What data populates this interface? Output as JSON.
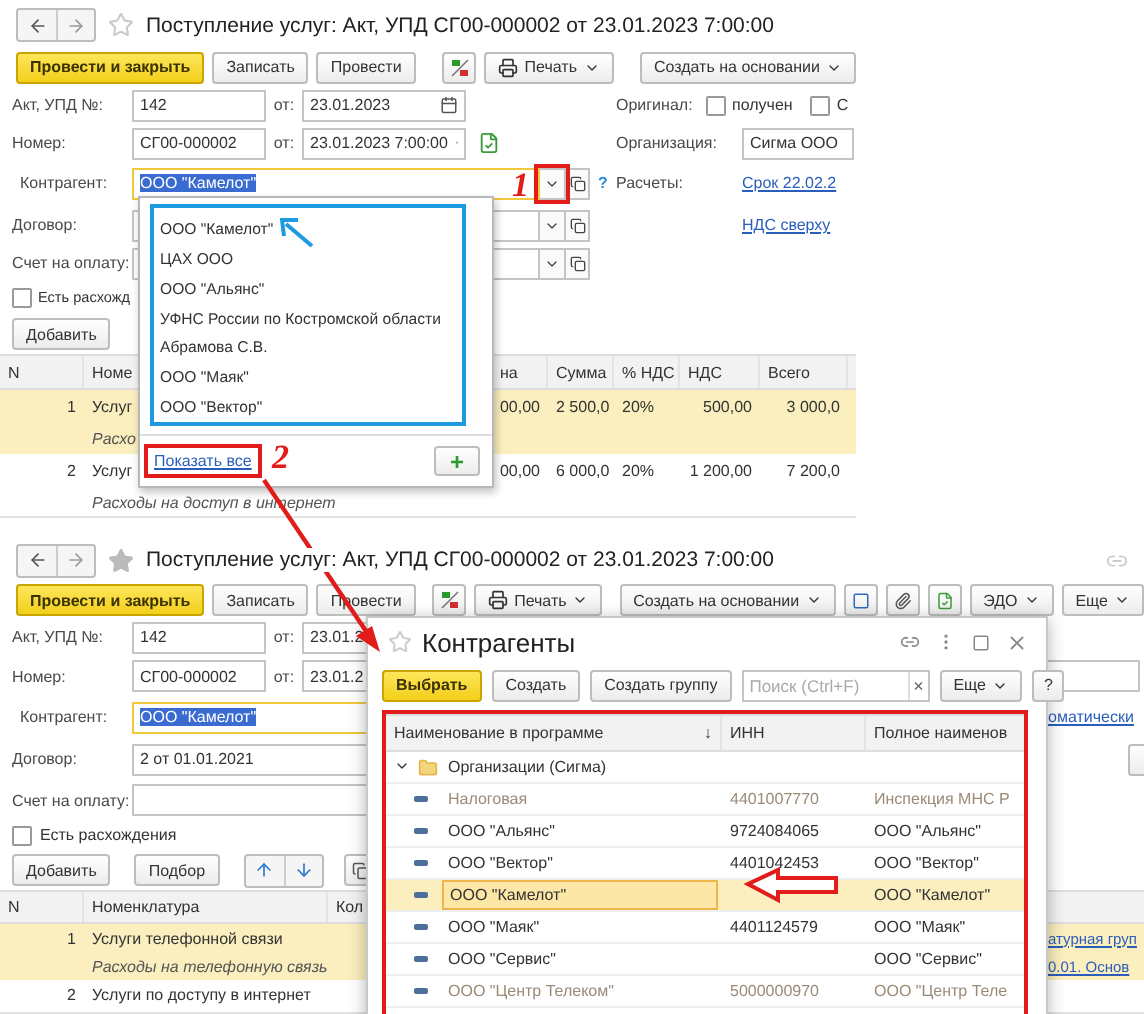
{
  "top_window": {
    "title": "Поступление услуг: Акт, УПД СГ00-000002 от 23.01.2023 7:00:00",
    "toolbar": [
      {
        "label": "Провести и закрыть",
        "kind": "primary"
      },
      {
        "label": "Записать",
        "kind": "plain"
      },
      {
        "label": "Провести",
        "kind": "plain"
      },
      {
        "label": "Печать",
        "kind": "print"
      },
      {
        "label": "Создать на основании",
        "kind": "menu"
      }
    ],
    "form": {
      "act_label": "Акт, УПД №:",
      "act_number": "142",
      "act_date_label": "от:",
      "act_date": "23.01.2023",
      "number_label": "Номер:",
      "number": "СГ00-000002",
      "date_label": "от:",
      "date": "23.01.2023  7:00:00",
      "counterparty_label": "Контрагент:",
      "counterparty": "ООО \"Камелот\"",
      "counterparty_text_selected": true,
      "help": "?",
      "contract_label": "Договор:",
      "invoice_label": "Счет на оплату:",
      "discrepancy": {
        "label": "Есть расхожд",
        "checked": false
      },
      "original_label": "Оригинал:",
      "original_checks": [
        {
          "label": "получен",
          "checked": false
        },
        {
          "label": "С",
          "checked": false
        }
      ],
      "organization_label": "Организация:",
      "organization": "Сигма ООО",
      "settlements_label": "Расчеты:",
      "settlements_link": "Срок 22.02.2",
      "vat_link": "НДС сверху"
    },
    "add_button": "Добавить",
    "table": {
      "columns": [
        "N",
        "Номе",
        "на",
        "Сумма",
        "% НДС",
        "НДС",
        "Всего"
      ],
      "rows": [
        {
          "n": "1",
          "name": "Услуг",
          "price": "00,00",
          "sum": "2 500,0",
          "vat_rate": "20%",
          "vat": "500,00",
          "total": "3 000,0",
          "note": "Расхо",
          "selected": true
        },
        {
          "n": "2",
          "name": "Услуг",
          "price": "00,00",
          "sum": "6 000,0",
          "vat_rate": "20%",
          "vat": "1 200,00",
          "total": "7 200,0",
          "note": "Расходы на доступ в интернет",
          "selected": false
        }
      ]
    }
  },
  "dropdown": {
    "items": [
      "ООО \"Камелот\"",
      "ЦАХ ООО",
      "ООО \"Альянс\"",
      "УФНС России по Костромской области",
      "Абрамова С.В.",
      "ООО \"Маяк\"",
      "ООО \"Вектор\""
    ],
    "show_all": "Показать все",
    "add": "+"
  },
  "bottom_window": {
    "title": "Поступление услуг: Акт, УПД СГ00-000002 от 23.01.2023 7:00:00",
    "toolbar": [
      {
        "label": "Провести и закрыть",
        "kind": "primary"
      },
      {
        "label": "Записать",
        "kind": "plain"
      },
      {
        "label": "Провести",
        "kind": "plain"
      },
      {
        "label": "Печать",
        "kind": "print"
      },
      {
        "label": "Создать на основании",
        "kind": "menu"
      }
    ],
    "edo": "ЭДО",
    "more": "Еще",
    "form": {
      "act_label": "Акт, УПД №:",
      "act_number": "142",
      "act_date_label": "от:",
      "act_date": "23.01.2",
      "number_label": "Номер:",
      "number": "СГ00-000002",
      "date_label": "от:",
      "date": "23.01.2",
      "counterparty_label": "Контрагент:",
      "counterparty": "ООО \"Камелот\"",
      "counterparty_text_selected": true,
      "contract_label": "Договор:",
      "contract": "2 от 01.01.2021",
      "invoice_label": "Счет на оплату:",
      "discrepancy": {
        "label": "Есть расхождения",
        "checked": false
      },
      "auto_link": "оматически"
    },
    "buttons": [
      "Добавить",
      "Подбор"
    ],
    "table": {
      "columns": [
        "N",
        "Номенклатура",
        "Кол"
      ],
      "rows": [
        {
          "n": "1",
          "name": "Услуги телефонной связи",
          "note": "Расходы на телефонную связь",
          "group_link": "атурная груп",
          "account_link": "0.01. Основ",
          "selected": true
        },
        {
          "n": "2",
          "name": "Услуги по доступу в интернет",
          "selected": false
        }
      ]
    }
  },
  "dialog": {
    "title": "Контрагенты",
    "buttons": [
      {
        "label": "Выбрать",
        "kind": "primary"
      },
      {
        "label": "Создать",
        "kind": "plain"
      },
      {
        "label": "Создать группу",
        "kind": "plain"
      }
    ],
    "search": {
      "placeholder": "Поиск (Ctrl+F)"
    },
    "clear": "×",
    "more": "Еще",
    "help": "?",
    "columns": [
      "Наименование в программе",
      "ИНН",
      "Полное наименов"
    ],
    "sort_mark": "↓",
    "group": {
      "label": "Организации (Сигма)",
      "expanded": true
    },
    "rows": [
      {
        "name": "Налоговая",
        "inn": "4401007770",
        "full_name": "Инспекция МНС Р",
        "grayed": true,
        "selected": false
      },
      {
        "name": "ООО \"Альянс\"",
        "inn": "9724084065",
        "full_name": "ООО \"Альянс\"",
        "grayed": false,
        "selected": false
      },
      {
        "name": "ООО \"Вектор\"",
        "inn": "4401042453",
        "full_name": "ООО \"Вектор\"",
        "grayed": false,
        "selected": false
      },
      {
        "name": "ООО \"Камелот\"",
        "full_name": "ООО \"Камелот\"",
        "grayed": false,
        "selected": true
      },
      {
        "name": "ООО \"Маяк\"",
        "inn": "4401124579",
        "full_name": "ООО \"Маяк\"",
        "grayed": false,
        "selected": false
      },
      {
        "name": "ООО \"Сервис\"",
        "full_name": "ООО \"Сервис\"",
        "grayed": false,
        "selected": false
      },
      {
        "name": "ООО \"Центр Телеком\"",
        "inn": "5000000970",
        "full_name": "ООО \"Центр Теле",
        "grayed": true,
        "selected": false
      }
    ]
  },
  "annotations": {
    "steps": [
      "1",
      "2"
    ]
  }
}
